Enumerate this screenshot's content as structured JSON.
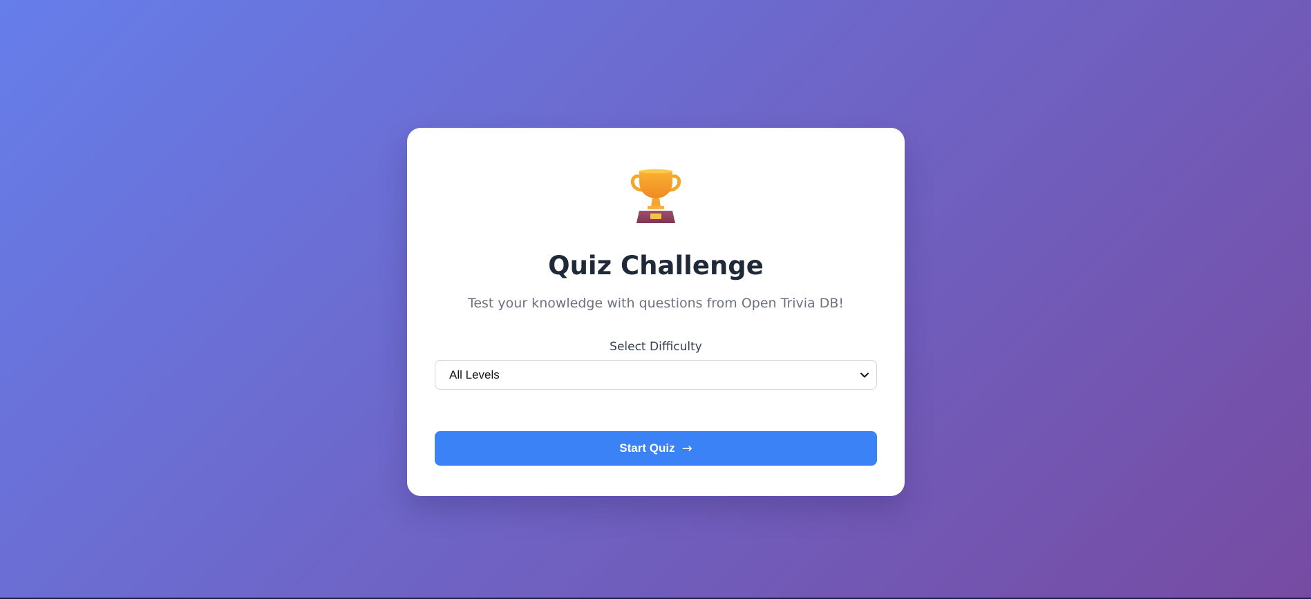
{
  "app": {
    "title": "Quiz Challenge",
    "subtitle": "Test your knowledge with questions from Open Trivia DB!",
    "icon": "trophy-icon"
  },
  "difficulty": {
    "label": "Select Difficulty",
    "selected": "All Levels"
  },
  "actions": {
    "start_label": "Start Quiz",
    "start_arrow": "→"
  },
  "colors": {
    "background_start": "#667eea",
    "background_end": "#764ba2",
    "primary_button": "#3b82f6",
    "title_text": "#1f2937",
    "subtitle_text": "#6b7280"
  }
}
